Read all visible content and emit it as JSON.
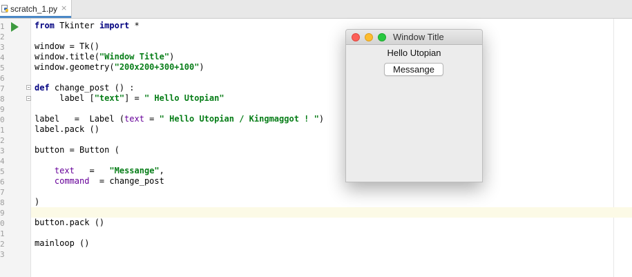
{
  "tab": {
    "filename": "scratch_1.py",
    "close_glyph": "×",
    "icon": "python-file-icon"
  },
  "gutter": {
    "line_numbers": [
      "1",
      "2",
      "3",
      "4",
      "5",
      "6",
      "7",
      "8",
      "9",
      "0",
      "1",
      "2",
      "3",
      "4",
      "5",
      "6",
      "7",
      "8",
      "9",
      "0",
      "1",
      "2",
      "3"
    ],
    "run_icon": "run-triangle-icon"
  },
  "code": {
    "line1": {
      "kw1": "from",
      "mod": " Tkinter ",
      "kw2": "import",
      "rest": " *"
    },
    "line3": "window = Tk()",
    "line4": {
      "pre": "window.title(",
      "str": "\"Window Title\"",
      "post": ")"
    },
    "line5": {
      "pre": "window.geometry(",
      "str": "\"200x200+300+100\"",
      "post": ")"
    },
    "line7": {
      "kw": "def",
      "rest": " change_post () :"
    },
    "line8": {
      "pre": "     label [",
      "str1": "\"text\"",
      "mid": "] = ",
      "str2": "\" Hello Utopian\""
    },
    "line10": {
      "pre": "label   =  Label (",
      "param": "text",
      "mid": " = ",
      "str": "\" Hello Utopian / Kingmaggot ! \"",
      "post": ")"
    },
    "line11": "label.pack ()",
    "line13": "button = Button (",
    "line15": {
      "indent": "    ",
      "param": "text",
      "mid": "   =   ",
      "str": "\"Messange\"",
      "post": ","
    },
    "line16": {
      "indent": "    ",
      "param": "command",
      "rest": "  = change_post"
    },
    "line18": ")",
    "line20": "button.pack ()",
    "line22": "mainloop ()"
  },
  "tk_window": {
    "title": "Window Title",
    "label": "Hello Utopian",
    "button": "Messange"
  },
  "colors": {
    "keyword": "#000080",
    "string": "#067d17",
    "param": "#660099",
    "run_icon": "#3d9a3f",
    "current_line": "#fcfae6",
    "tab_underline": "#4a88c7"
  }
}
